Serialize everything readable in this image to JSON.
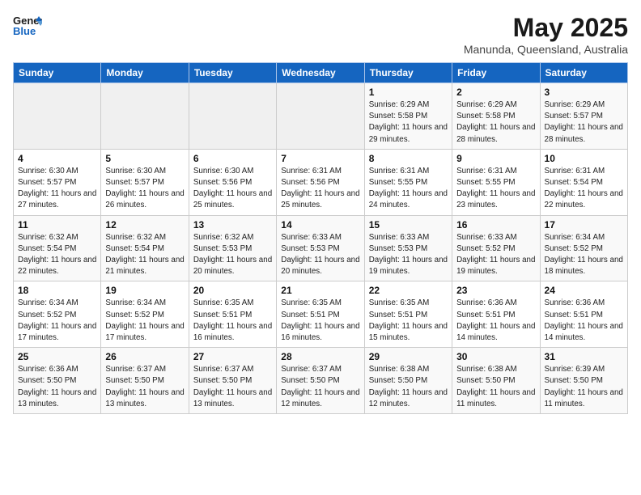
{
  "header": {
    "logo_line1": "General",
    "logo_line2": "Blue",
    "month_year": "May 2025",
    "location": "Manunda, Queensland, Australia"
  },
  "weekdays": [
    "Sunday",
    "Monday",
    "Tuesday",
    "Wednesday",
    "Thursday",
    "Friday",
    "Saturday"
  ],
  "weeks": [
    [
      {
        "day": "",
        "info": ""
      },
      {
        "day": "",
        "info": ""
      },
      {
        "day": "",
        "info": ""
      },
      {
        "day": "",
        "info": ""
      },
      {
        "day": "1",
        "info": "Sunrise: 6:29 AM\nSunset: 5:58 PM\nDaylight: 11 hours and 29 minutes."
      },
      {
        "day": "2",
        "info": "Sunrise: 6:29 AM\nSunset: 5:58 PM\nDaylight: 11 hours and 28 minutes."
      },
      {
        "day": "3",
        "info": "Sunrise: 6:29 AM\nSunset: 5:57 PM\nDaylight: 11 hours and 28 minutes."
      }
    ],
    [
      {
        "day": "4",
        "info": "Sunrise: 6:30 AM\nSunset: 5:57 PM\nDaylight: 11 hours and 27 minutes."
      },
      {
        "day": "5",
        "info": "Sunrise: 6:30 AM\nSunset: 5:57 PM\nDaylight: 11 hours and 26 minutes."
      },
      {
        "day": "6",
        "info": "Sunrise: 6:30 AM\nSunset: 5:56 PM\nDaylight: 11 hours and 25 minutes."
      },
      {
        "day": "7",
        "info": "Sunrise: 6:31 AM\nSunset: 5:56 PM\nDaylight: 11 hours and 25 minutes."
      },
      {
        "day": "8",
        "info": "Sunrise: 6:31 AM\nSunset: 5:55 PM\nDaylight: 11 hours and 24 minutes."
      },
      {
        "day": "9",
        "info": "Sunrise: 6:31 AM\nSunset: 5:55 PM\nDaylight: 11 hours and 23 minutes."
      },
      {
        "day": "10",
        "info": "Sunrise: 6:31 AM\nSunset: 5:54 PM\nDaylight: 11 hours and 22 minutes."
      }
    ],
    [
      {
        "day": "11",
        "info": "Sunrise: 6:32 AM\nSunset: 5:54 PM\nDaylight: 11 hours and 22 minutes."
      },
      {
        "day": "12",
        "info": "Sunrise: 6:32 AM\nSunset: 5:54 PM\nDaylight: 11 hours and 21 minutes."
      },
      {
        "day": "13",
        "info": "Sunrise: 6:32 AM\nSunset: 5:53 PM\nDaylight: 11 hours and 20 minutes."
      },
      {
        "day": "14",
        "info": "Sunrise: 6:33 AM\nSunset: 5:53 PM\nDaylight: 11 hours and 20 minutes."
      },
      {
        "day": "15",
        "info": "Sunrise: 6:33 AM\nSunset: 5:53 PM\nDaylight: 11 hours and 19 minutes."
      },
      {
        "day": "16",
        "info": "Sunrise: 6:33 AM\nSunset: 5:52 PM\nDaylight: 11 hours and 19 minutes."
      },
      {
        "day": "17",
        "info": "Sunrise: 6:34 AM\nSunset: 5:52 PM\nDaylight: 11 hours and 18 minutes."
      }
    ],
    [
      {
        "day": "18",
        "info": "Sunrise: 6:34 AM\nSunset: 5:52 PM\nDaylight: 11 hours and 17 minutes."
      },
      {
        "day": "19",
        "info": "Sunrise: 6:34 AM\nSunset: 5:52 PM\nDaylight: 11 hours and 17 minutes."
      },
      {
        "day": "20",
        "info": "Sunrise: 6:35 AM\nSunset: 5:51 PM\nDaylight: 11 hours and 16 minutes."
      },
      {
        "day": "21",
        "info": "Sunrise: 6:35 AM\nSunset: 5:51 PM\nDaylight: 11 hours and 16 minutes."
      },
      {
        "day": "22",
        "info": "Sunrise: 6:35 AM\nSunset: 5:51 PM\nDaylight: 11 hours and 15 minutes."
      },
      {
        "day": "23",
        "info": "Sunrise: 6:36 AM\nSunset: 5:51 PM\nDaylight: 11 hours and 14 minutes."
      },
      {
        "day": "24",
        "info": "Sunrise: 6:36 AM\nSunset: 5:51 PM\nDaylight: 11 hours and 14 minutes."
      }
    ],
    [
      {
        "day": "25",
        "info": "Sunrise: 6:36 AM\nSunset: 5:50 PM\nDaylight: 11 hours and 13 minutes."
      },
      {
        "day": "26",
        "info": "Sunrise: 6:37 AM\nSunset: 5:50 PM\nDaylight: 11 hours and 13 minutes."
      },
      {
        "day": "27",
        "info": "Sunrise: 6:37 AM\nSunset: 5:50 PM\nDaylight: 11 hours and 13 minutes."
      },
      {
        "day": "28",
        "info": "Sunrise: 6:37 AM\nSunset: 5:50 PM\nDaylight: 11 hours and 12 minutes."
      },
      {
        "day": "29",
        "info": "Sunrise: 6:38 AM\nSunset: 5:50 PM\nDaylight: 11 hours and 12 minutes."
      },
      {
        "day": "30",
        "info": "Sunrise: 6:38 AM\nSunset: 5:50 PM\nDaylight: 11 hours and 11 minutes."
      },
      {
        "day": "31",
        "info": "Sunrise: 6:39 AM\nSunset: 5:50 PM\nDaylight: 11 hours and 11 minutes."
      }
    ]
  ]
}
